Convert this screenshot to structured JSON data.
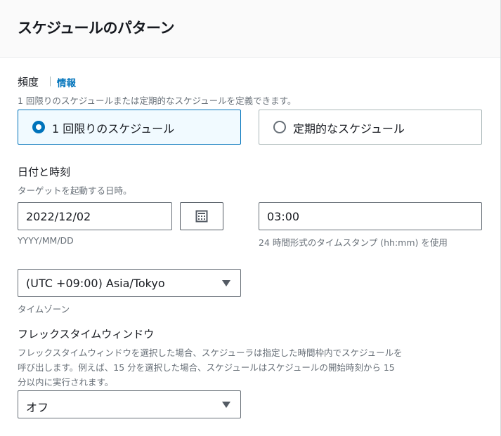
{
  "header": {
    "title": "スケジュールのパターン"
  },
  "frequency": {
    "label": "頻度",
    "info_link": "情報",
    "description": "1 回限りのスケジュールまたは定期的なスケジュールを定義できます。",
    "options": [
      {
        "label": "1 回限りのスケジュール",
        "selected": true
      },
      {
        "label": "定期的なスケジュール",
        "selected": false
      }
    ]
  },
  "datetime": {
    "label": "日付と時刻",
    "description": "ターゲットを起動する日時。",
    "date_value": "2022/12/02",
    "date_hint": "YYYY/MM/DD",
    "calendar_icon": "calendar-icon",
    "time_value": "03:00",
    "time_hint": "24 時間形式のタイムスタンプ (hh:mm) を使用"
  },
  "timezone": {
    "value": "(UTC +09:00) Asia/Tokyo",
    "hint": "タイムゾーン"
  },
  "flex_window": {
    "label": "フレックスタイムウィンドウ",
    "description_line1": "フレックスタイムウィンドウを選択した場合、スケジューラは指定した時間枠内でスケジュールを",
    "description_line2": "呼び出します。例えば、15 分を選択した場合、スケジュールはスケジュールの開始時刻から 15",
    "description_line3": "分以内に実行されます。",
    "value": "オフ"
  },
  "colors": {
    "accent": "#0073bb",
    "selected_bg": "#f1faff",
    "muted_text": "#687078"
  }
}
